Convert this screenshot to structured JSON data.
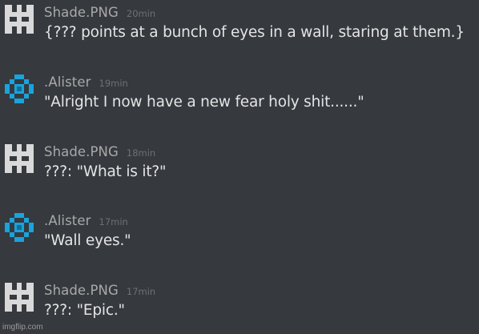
{
  "messages": [
    {
      "author": "Shade.PNG",
      "time": "20min",
      "avatar_icon": "white-pixel-block-avatar",
      "text": "{??? points at a bunch of eyes in a wall, staring at them.}"
    },
    {
      "author": ".Alister",
      "time": "19min",
      "avatar_icon": "blue-pixel-diamond-avatar",
      "text": "\"Alright I now have a new fear holy shit......\""
    },
    {
      "author": "Shade.PNG",
      "time": "18min",
      "avatar_icon": "white-pixel-block-avatar",
      "text": "???: \"What is it?\""
    },
    {
      "author": ".Alister",
      "time": "17min",
      "avatar_icon": "blue-pixel-diamond-avatar",
      "text": "\"Wall eyes.\""
    },
    {
      "author": "Shade.PNG",
      "time": "17min",
      "avatar_icon": "white-pixel-block-avatar",
      "text": "???: \"Epic.\""
    }
  ],
  "watermark": "imgflip.com",
  "colors": {
    "background": "#36393e",
    "username": "#a9a9a9",
    "timestamp": "#6e7075",
    "message_text": "#e4e4e4",
    "shade_avatar": "#d9d9d9",
    "alister_avatar": "#1aa3dc"
  }
}
